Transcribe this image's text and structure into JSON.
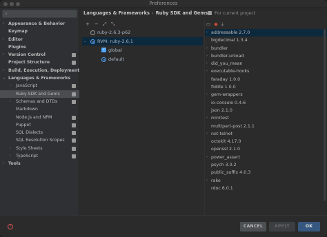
{
  "window": {
    "title": "Preferences"
  },
  "breadcrumb": {
    "parent": "Languages & Frameworks",
    "separator": "›",
    "current": "Ruby SDK and Gems"
  },
  "scope": {
    "label": "For current project"
  },
  "sidebar": {
    "items": [
      {
        "label": "Appearance & Behavior",
        "bold": true,
        "arrow": "›",
        "project": false,
        "selected": false
      },
      {
        "label": "Keymap",
        "bold": true,
        "arrow": "",
        "project": false,
        "selected": false
      },
      {
        "label": "Editor",
        "bold": true,
        "arrow": "›",
        "project": false,
        "selected": false
      },
      {
        "label": "Plugins",
        "bold": true,
        "arrow": "",
        "project": false,
        "selected": false
      },
      {
        "label": "Version Control",
        "bold": true,
        "arrow": "›",
        "project": true,
        "selected": false
      },
      {
        "label": "Project Structure",
        "bold": true,
        "arrow": "",
        "project": true,
        "selected": false
      },
      {
        "label": "Build, Execution, Deployment",
        "bold": true,
        "arrow": "›",
        "project": false,
        "selected": false
      },
      {
        "label": "Languages & Frameworks",
        "bold": true,
        "arrow": "⌄",
        "project": false,
        "selected": false
      },
      {
        "label": "JavaScript",
        "bold": false,
        "arrow": "›",
        "project": true,
        "selected": false
      },
      {
        "label": "Ruby SDK and Gems",
        "bold": false,
        "arrow": "",
        "project": true,
        "selected": true
      },
      {
        "label": "Schemas and DTDs",
        "bold": false,
        "arrow": "›",
        "project": true,
        "selected": false
      },
      {
        "label": "Markdown",
        "bold": false,
        "arrow": "",
        "project": false,
        "selected": false
      },
      {
        "label": "Node.js and NPM",
        "bold": false,
        "arrow": "",
        "project": true,
        "selected": false
      },
      {
        "label": "Puppet",
        "bold": false,
        "arrow": "",
        "project": true,
        "selected": false
      },
      {
        "label": "SQL Dialects",
        "bold": false,
        "arrow": "",
        "project": true,
        "selected": false
      },
      {
        "label": "SQL Resolution Scopes",
        "bold": false,
        "arrow": "",
        "project": true,
        "selected": false
      },
      {
        "label": "Style Sheets",
        "bold": false,
        "arrow": "›",
        "project": true,
        "selected": false
      },
      {
        "label": "TypeScript",
        "bold": false,
        "arrow": "›",
        "project": true,
        "selected": false
      },
      {
        "label": "Tools",
        "bold": true,
        "arrow": "›",
        "project": false,
        "selected": false
      }
    ]
  },
  "sdk_toolbar": {
    "add": "+",
    "remove": "−",
    "expand": "⤢",
    "collapse": "⤡"
  },
  "sdks": [
    {
      "label": "ruby-2.6.3-p62",
      "kind": "radio",
      "checked": false,
      "selected": false,
      "arrow": ""
    },
    {
      "label": "RVM: ruby-2.6.1",
      "kind": "radio",
      "checked": true,
      "selected": true,
      "arrow": "⌄"
    },
    {
      "label": "global",
      "kind": "check",
      "checked": true,
      "selected": false,
      "arrow": ""
    },
    {
      "label": "default",
      "kind": "radio",
      "checked": true,
      "selected": false,
      "arrow": ""
    }
  ],
  "gems": [
    {
      "label": "addressable 2.7.0",
      "arrow": "›",
      "selected": true
    },
    {
      "label": "bigdecimal 1.3.4",
      "arrow": "",
      "selected": false
    },
    {
      "label": "bundler",
      "arrow": "›",
      "selected": false
    },
    {
      "label": "bundler-unload",
      "arrow": "›",
      "selected": false
    },
    {
      "label": "did_you_mean",
      "arrow": "›",
      "selected": false
    },
    {
      "label": "executable-hooks",
      "arrow": "›",
      "selected": false
    },
    {
      "label": "faraday 1.0.0",
      "arrow": "",
      "selected": false
    },
    {
      "label": "fiddle 1.0.0",
      "arrow": "",
      "selected": false
    },
    {
      "label": "gem-wrappers",
      "arrow": "›",
      "selected": false
    },
    {
      "label": "io-console 0.4.6",
      "arrow": "",
      "selected": false
    },
    {
      "label": "json 2.1.0",
      "arrow": "",
      "selected": false
    },
    {
      "label": "minitest",
      "arrow": "›",
      "selected": false
    },
    {
      "label": "multipart-post 2.1.1",
      "arrow": "",
      "selected": false
    },
    {
      "label": "net-telnet",
      "arrow": "›",
      "selected": false
    },
    {
      "label": "octokit 4.17.0",
      "arrow": "",
      "selected": false
    },
    {
      "label": "openssl 2.1.0",
      "arrow": "",
      "selected": false
    },
    {
      "label": "power_assert",
      "arrow": "›",
      "selected": false
    },
    {
      "label": "psych 3.0.2",
      "arrow": "",
      "selected": false
    },
    {
      "label": "public_suffix 4.0.3",
      "arrow": "",
      "selected": false
    },
    {
      "label": "rake",
      "arrow": "›",
      "selected": false
    },
    {
      "label": "rdoc 6.0.1",
      "arrow": "",
      "selected": false
    }
  ],
  "buttons": {
    "cancel": "CANCEL",
    "apply": "APPLY",
    "ok": "OK",
    "help": "?"
  },
  "colors": {
    "accent": "#4ca5ff",
    "selection": "#0d293e",
    "ok_button": "#365880",
    "help": "#d05353"
  }
}
